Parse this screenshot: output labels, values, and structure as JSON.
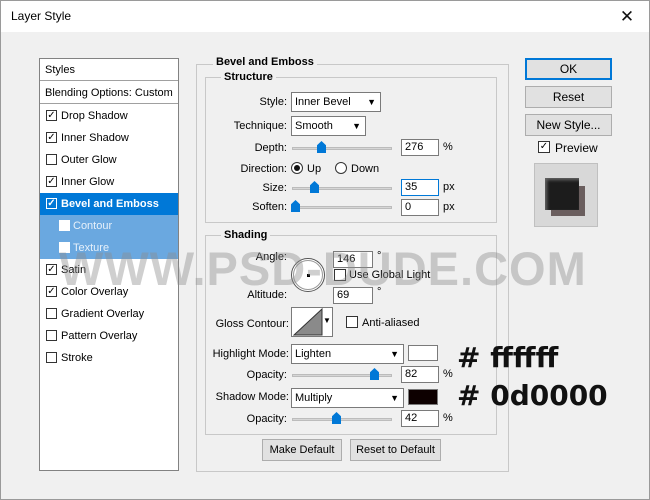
{
  "window": {
    "title": "Layer Style",
    "close_icon": "close-icon"
  },
  "left_list": {
    "header": "Styles",
    "blending": "Blending Options: Custom",
    "items": [
      {
        "label": "Drop Shadow",
        "checked": true
      },
      {
        "label": "Inner Shadow",
        "checked": true
      },
      {
        "label": "Outer Glow",
        "checked": false
      },
      {
        "label": "Inner Glow",
        "checked": true
      },
      {
        "label": "Bevel and Emboss",
        "checked": true,
        "selected": true
      },
      {
        "label": "Contour",
        "checked": false,
        "sub": true
      },
      {
        "label": "Texture",
        "checked": false,
        "sub": true
      },
      {
        "label": "Satin",
        "checked": true
      },
      {
        "label": "Color Overlay",
        "checked": true
      },
      {
        "label": "Gradient Overlay",
        "checked": false
      },
      {
        "label": "Pattern Overlay",
        "checked": false
      },
      {
        "label": "Stroke",
        "checked": false
      }
    ]
  },
  "bevel": {
    "title": "Bevel and Emboss",
    "structure": {
      "title": "Structure",
      "style_label": "Style:",
      "style_value": "Inner Bevel",
      "technique_label": "Technique:",
      "technique_value": "Smooth",
      "depth_label": "Depth:",
      "depth_value": "276",
      "depth_unit": "%",
      "direction_label": "Direction:",
      "dir_up": "Up",
      "dir_down": "Down",
      "size_label": "Size:",
      "size_value": "35",
      "size_unit": "px",
      "soften_label": "Soften:",
      "soften_value": "0",
      "soften_unit": "px"
    },
    "shading": {
      "title": "Shading",
      "angle_label": "Angle:",
      "angle_value": "146",
      "angle_unit": "°",
      "global_light": "Use Global Light",
      "altitude_label": "Altitude:",
      "altitude_value": "69",
      "altitude_unit": "°",
      "gloss_label": "Gloss Contour:",
      "anti_aliased": "Anti-aliased",
      "highlight_label": "Highlight Mode:",
      "highlight_value": "Lighten",
      "highlight_color": "#ffffff",
      "hl_opacity_label": "Opacity:",
      "hl_opacity_value": "82",
      "hl_opacity_unit": "%",
      "shadow_label": "Shadow Mode:",
      "shadow_value": "Multiply",
      "shadow_color": "#0d0000",
      "sh_opacity_label": "Opacity:",
      "sh_opacity_value": "42",
      "sh_opacity_unit": "%"
    },
    "make_default": "Make Default",
    "reset_default": "Reset to Default"
  },
  "buttons": {
    "ok": "OK",
    "reset": "Reset",
    "new_style": "New Style...",
    "preview": "Preview"
  },
  "watermark": "WWW.PSD-DUDE.COM",
  "annotations": {
    "highlight_hex": "# ffffff",
    "shadow_hex": "# 0d0000"
  },
  "accent_color": "#0078d7"
}
